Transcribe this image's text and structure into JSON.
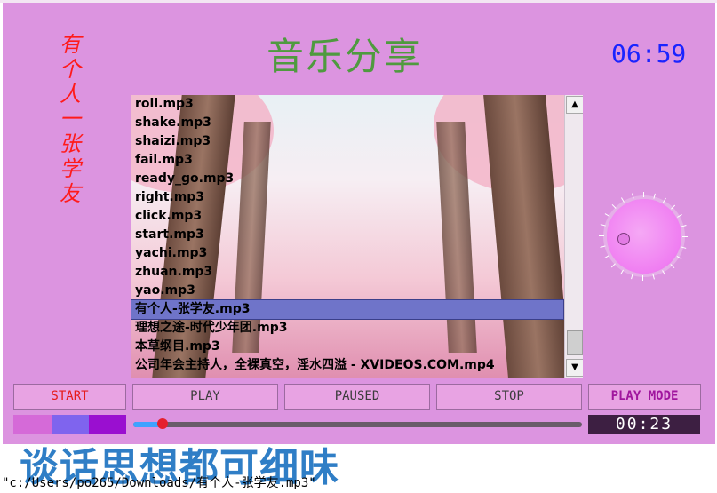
{
  "side_text": [
    "有",
    "个",
    "人",
    "一",
    "张",
    "学",
    "友"
  ],
  "app_title": "音乐分享",
  "clock": "06:59",
  "playlist": {
    "tracks": [
      "roll.mp3",
      "shake.mp3",
      "shaizi.mp3",
      "fail.mp3",
      "ready_go.mp3",
      "right.mp3",
      "click.mp3",
      "start.mp3",
      "yachi.mp3",
      "zhuan.mp3",
      "yao.mp3",
      "有个人-张学友.mp3",
      "理想之途-时代少年团.mp3",
      "本草纲目.mp3",
      "公司年会主持人，全裸真空，淫水四溢 - XVIDEOS.COM.mp4"
    ],
    "selected_index": 11
  },
  "scrollbar": {
    "up_icon": "arrow-up-icon",
    "down_icon": "arrow-down-icon"
  },
  "controls": {
    "start_label": "START",
    "play_label": "PLAY",
    "paused_label": "PAUSED",
    "stop_label": "STOP",
    "play_mode_label": "PLAY MODE"
  },
  "volume_knob": {
    "icon": "volume-knob-icon"
  },
  "swatches": [
    "#d56ad8",
    "#7f64ee",
    "#9a0fd0"
  ],
  "progress": {
    "fraction": 0.065,
    "elapsed": "00:23"
  },
  "banner_text": "谈话思想都可细味",
  "status_path": "\"c:/Users/po265/Downloads/有个人-张学友.mp3\"",
  "colors": {
    "window_bg": "#dc94e0",
    "title": "#4f9a3f",
    "clock": "#1a24ff",
    "side_text": "#ff1a1a",
    "banner": "#2f7ec6",
    "selected_row": "#6f74c9"
  }
}
